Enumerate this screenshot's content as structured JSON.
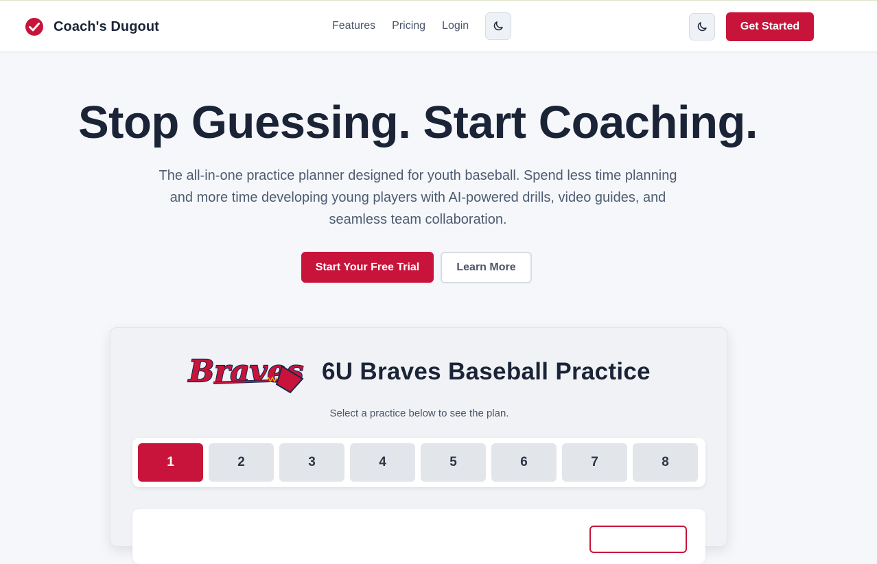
{
  "header": {
    "brand_name": "Coach's Dugout",
    "brand_icon": "check-circle-icon",
    "nav": [
      "Features",
      "Pricing",
      "Login"
    ],
    "theme_icon": "moon-icon",
    "cta_label": "Get Started"
  },
  "hero": {
    "title": "Stop Guessing. Start Coaching.",
    "subtitle": "The all-in-one practice planner designed for youth baseball. Spend less time planning and more time developing young players with AI-powered drills, video guides, and seamless team collaboration.",
    "primary_cta": "Start Your Free Trial",
    "secondary_cta": "Learn More"
  },
  "demo": {
    "team_logo": "Braves",
    "title": "6U Braves Baseball Practice",
    "subtitle": "Select a practice below to see the plan.",
    "practices": [
      "1",
      "2",
      "3",
      "4",
      "5",
      "6",
      "7",
      "8"
    ],
    "selected_practice": "1"
  },
  "colors": {
    "accent": "#c8143a",
    "navy": "#1b2437",
    "background": "#f5f7fa"
  }
}
